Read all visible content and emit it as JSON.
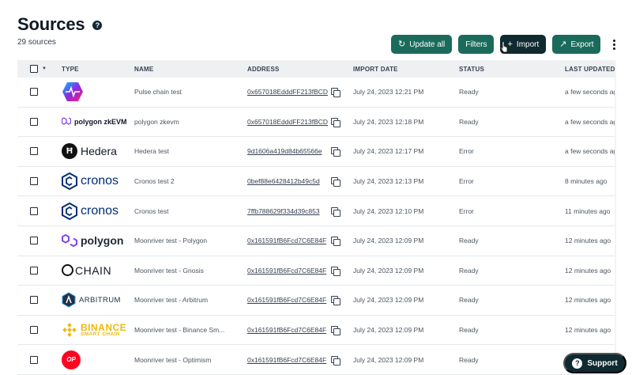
{
  "header": {
    "title": "Sources",
    "count": "29 sources"
  },
  "toolbar": {
    "update_all": "Update all",
    "filters": "Filters",
    "import": "Import",
    "export": "Export"
  },
  "table": {
    "columns": [
      "TYPE",
      "NAME",
      "ADDRESS",
      "IMPORT DATE",
      "STATUS",
      "LAST UPDATED"
    ],
    "rows": [
      {
        "logo": "pulsechain",
        "logo_text": "",
        "name": "Pulse chain test",
        "address": "0x657018EdddFF213fBCD",
        "date": "July 24, 2023 12:21 PM",
        "status": "Ready",
        "updated": "a few seconds ago"
      },
      {
        "logo": "polygon-zkevm",
        "logo_text": "polygon zkEVM",
        "name": "polygon zkevm",
        "address": "0x657018EdddFF213fBCD",
        "date": "July 24, 2023 12:18 PM",
        "status": "Ready",
        "updated": "a few seconds ago"
      },
      {
        "logo": "hedera",
        "logo_text": "Hedera",
        "name": "Hedera test",
        "address": "9d1606a419d84b65566e",
        "date": "July 24, 2023 12:17 PM",
        "status": "Error",
        "updated": "a few seconds ago"
      },
      {
        "logo": "cronos",
        "logo_text": "cronos",
        "name": "Cronos test 2",
        "address": "0bef88e6428412b49c5d",
        "date": "July 24, 2023 12:13 PM",
        "status": "Error",
        "updated": "8 minutes ago"
      },
      {
        "logo": "cronos",
        "logo_text": "cronos",
        "name": "Cronos test",
        "address": "7ffb788629f334d39c853",
        "date": "July 24, 2023 12:10 PM",
        "status": "Error",
        "updated": "11 minutes ago"
      },
      {
        "logo": "polygon",
        "logo_text": "polygon",
        "name": "Moonriver test - Polygon",
        "address": "0x161591fB6Fcd7C6E84F",
        "date": "July 24, 2023 12:09 PM",
        "status": "Ready",
        "updated": "12 minutes ago"
      },
      {
        "logo": "gnosis",
        "logo_text": "CHAIN",
        "name": "Moonriver test - Gnosis",
        "address": "0x161591fB6Fcd7C6E84F",
        "date": "July 24, 2023 12:09 PM",
        "status": "Ready",
        "updated": "12 minutes ago"
      },
      {
        "logo": "arbitrum",
        "logo_text": "ARBITRUM",
        "name": "Moonriver test - Arbitrum",
        "address": "0x161591fB6Fcd7C6E84F",
        "date": "July 24, 2023 12:09 PM",
        "status": "Ready",
        "updated": "12 minutes ago"
      },
      {
        "logo": "binance",
        "logo_text": "BINANCE",
        "logo_sub": "SMART CHAIN",
        "name": "Moonriver test - Binance Sm...",
        "address": "0x161591fB6Fcd7C6E84F",
        "date": "July 24, 2023 12:09 PM",
        "status": "Ready",
        "updated": "12 minutes ago"
      },
      {
        "logo": "optimism",
        "logo_text": "OP",
        "name": "Moonriver test - Optimism",
        "address": "0x161591fB6Fcd7C6E84F",
        "date": "July 24, 2023 12:09 PM",
        "status": "Ready",
        "updated": "12 minutes ago"
      }
    ]
  },
  "support": {
    "label": "Support"
  },
  "colors": {
    "primary": "#1b6b5c",
    "dark": "#0f2a30",
    "header_bg": "#eef0f2",
    "optimism": "#ff0420",
    "binance": "#f0b90b",
    "polygon": "#8247e5",
    "cronos": "#002d74"
  }
}
